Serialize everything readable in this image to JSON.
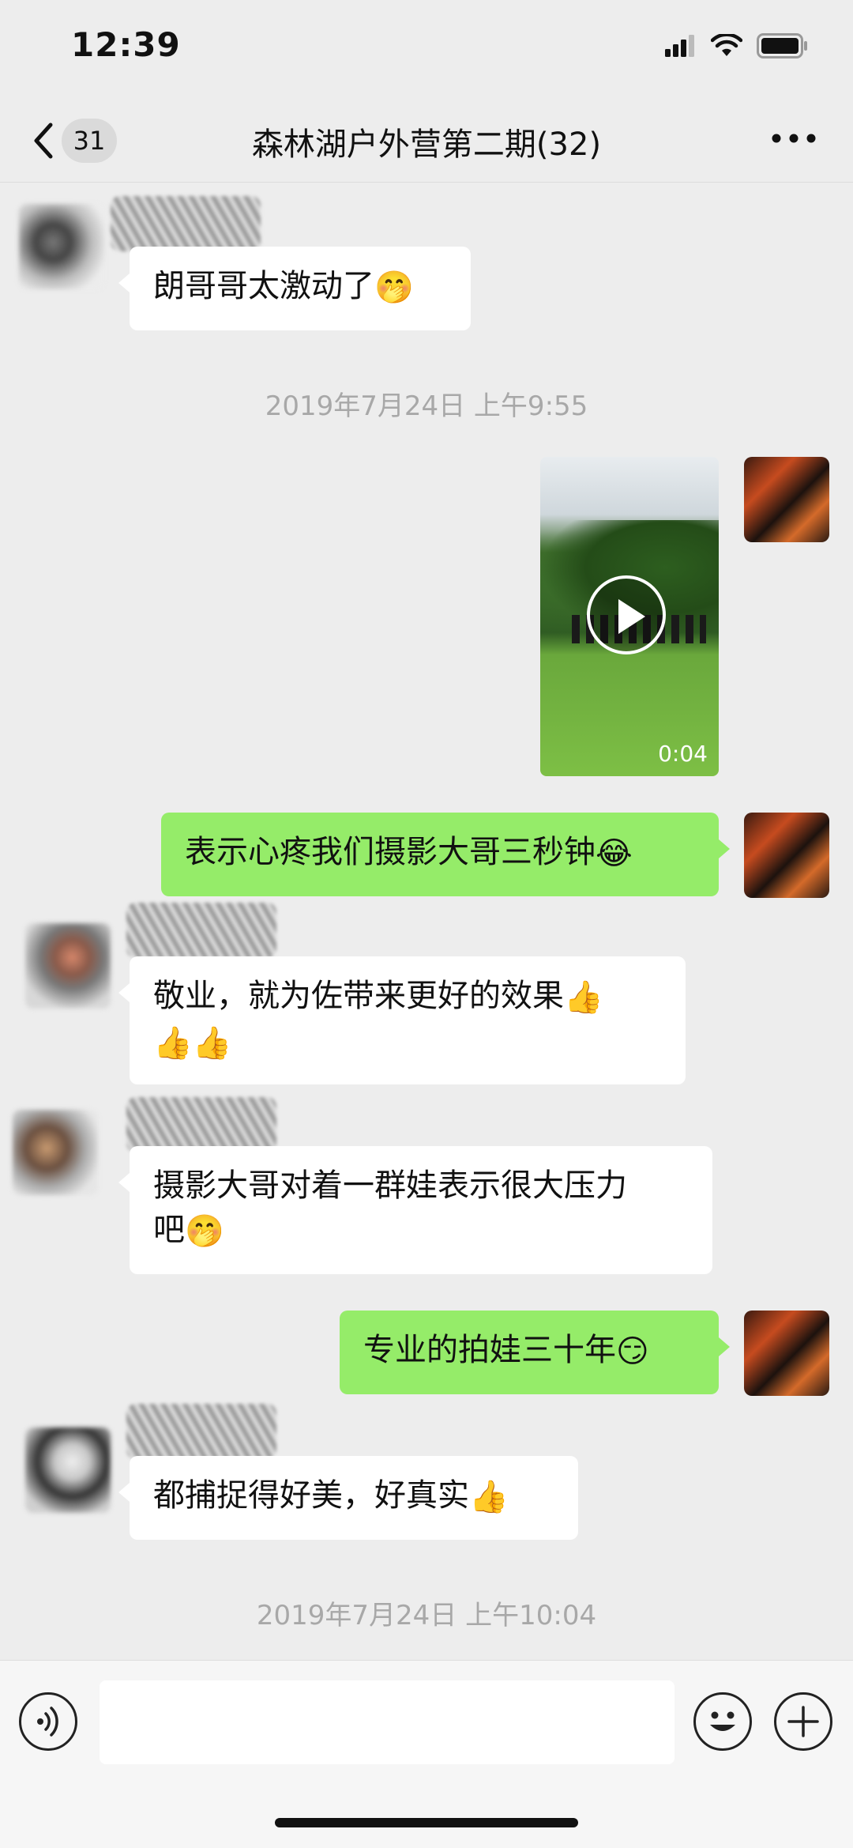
{
  "status_bar": {
    "time": "12:39"
  },
  "nav": {
    "unread_count": "31",
    "title": "森林湖户外营第二期(32)"
  },
  "timestamps": [
    "2019年7月24日 上午9:55",
    "2019年7月24日 上午10:04"
  ],
  "messages": [
    {
      "side": "in",
      "text": "朗哥哥太激动了",
      "emoji": "🤭"
    },
    {
      "side": "out",
      "type": "video",
      "duration": "0:04"
    },
    {
      "side": "out",
      "text": "表示心疼我们摄影大哥三秒钟",
      "emoji": "😂"
    },
    {
      "side": "in",
      "text": "敬业，就为佐带来更好的效果",
      "emoji": "👍",
      "emoji2": "👍👍"
    },
    {
      "side": "in",
      "text": "摄影大哥对着一群娃表示很大压力",
      "text2": "吧",
      "emoji": "🤭"
    },
    {
      "side": "out",
      "text": "专业的拍娃三十年",
      "emoji": "😏"
    },
    {
      "side": "in",
      "text": "都捕捉得好美，好真实",
      "emoji": "👍"
    }
  ],
  "input_bar": {
    "placeholder": ""
  },
  "colors": {
    "background": "#ededed",
    "outgoing_bubble": "#95ec69",
    "incoming_bubble": "#ffffff"
  }
}
